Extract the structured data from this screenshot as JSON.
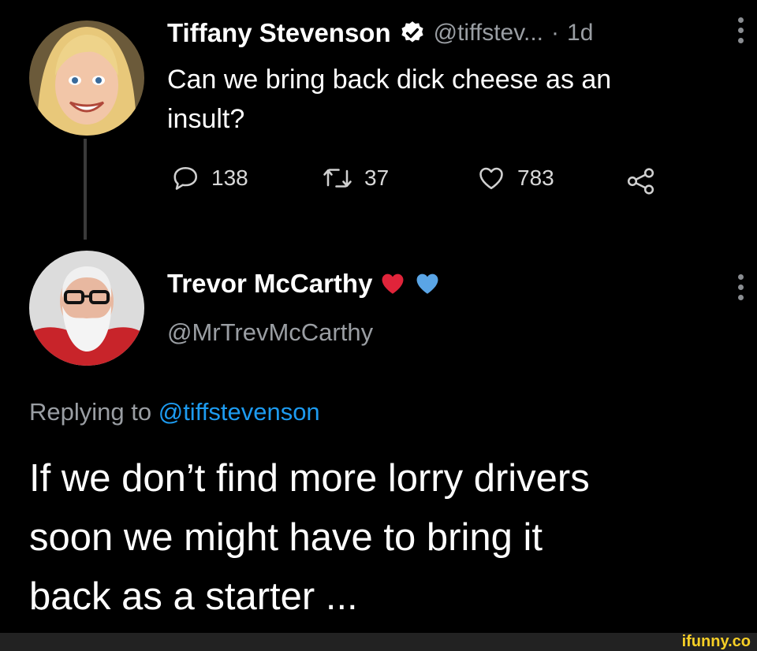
{
  "original_tweet": {
    "author_name": "Tiffany Stevenson",
    "handle": "@tiffstev...",
    "separator": "·",
    "time": "1d",
    "text_line1": "Can we bring back dick cheese as an",
    "text_line2": "insult?",
    "replies": "138",
    "retweets": "37",
    "likes": "783"
  },
  "reply_tweet": {
    "author_name": "Trevor McCarthy",
    "handle": "@MrTrevMcCarthy",
    "replying_prefix": "Replying to",
    "replying_handle": "@tiffstevenson",
    "text_line1": "If we don’t find more lorry drivers",
    "text_line2": "soon we might have to bring it",
    "text_line3": "back as a starter ..."
  },
  "colors": {
    "background": "#000000",
    "link": "#1d9bf0",
    "heart_red": "#e0243a",
    "heart_blue": "#5aa5e6",
    "watermark": "#f7cf26"
  },
  "watermark": "ifunny.co",
  "icons": [
    "verified-badge-icon",
    "reply-icon",
    "retweet-icon",
    "like-icon",
    "share-icon",
    "more-options-icon",
    "red-heart-icon",
    "blue-heart-icon"
  ]
}
